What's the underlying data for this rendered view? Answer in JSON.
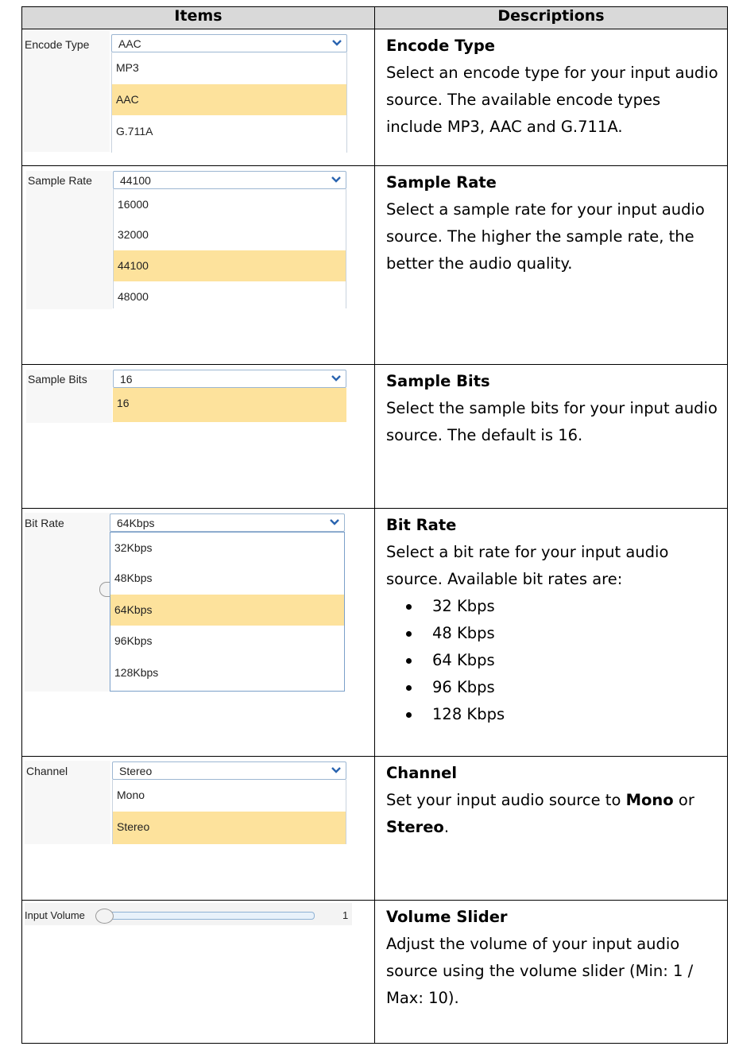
{
  "header": {
    "items": "Items",
    "descriptions": "Descriptions"
  },
  "rows": [
    {
      "label": "Encode Type",
      "selected_value": "AAC",
      "options": [
        "MP3",
        "AAC",
        "G.711A"
      ],
      "desc_title": "Encode Type",
      "desc_text": "Select an encode type for your input audio source. The available encode types include MP3, AAC and G.711A."
    },
    {
      "label": "Sample Rate",
      "selected_value": "44100",
      "options": [
        "16000",
        "32000",
        "44100",
        "48000"
      ],
      "desc_title": "Sample Rate",
      "desc_text": "Select a sample rate for your input audio source. The higher the sample rate, the better the audio quality."
    },
    {
      "label": "Sample Bits",
      "selected_value": "16",
      "options": [
        "16"
      ],
      "desc_title": "Sample Bits",
      "desc_text": "Select the sample bits for your input audio source. The default is 16."
    },
    {
      "label": "Bit Rate",
      "selected_value": "64Kbps",
      "options": [
        "32Kbps",
        "48Kbps",
        "64Kbps",
        "96Kbps",
        "128Kbps"
      ],
      "desc_title": "Bit Rate",
      "desc_text": "Select a bit rate for your input audio source. Available bit rates are:",
      "bullets": [
        "32 Kbps",
        "48 Kbps",
        "64 Kbps",
        "96 Kbps",
        "128 Kbps"
      ]
    },
    {
      "label": "Channel",
      "selected_value": "Stereo",
      "options": [
        "Mono",
        "Stereo"
      ],
      "desc_title": "Channel",
      "desc_pre": "Set your input audio source to ",
      "desc_bold1": "Mono",
      "desc_mid": " or ",
      "desc_bold2": "Stereo",
      "desc_post": "."
    },
    {
      "label": "Input Volume",
      "slider_value": "1",
      "slider_fraction": 0,
      "desc_title": "Volume Slider",
      "desc_text": "Adjust the volume of your input audio source using the volume slider (Min: 1 / Max: 10)."
    }
  ],
  "colors": {
    "header_bg": "#d9d9d9",
    "highlight": "#fde29c",
    "select_border": "#9cb6d2",
    "chevron": "#2a64b0"
  },
  "icons": {
    "dropdown": "chevron-down-icon",
    "slider": "slider-knob"
  }
}
